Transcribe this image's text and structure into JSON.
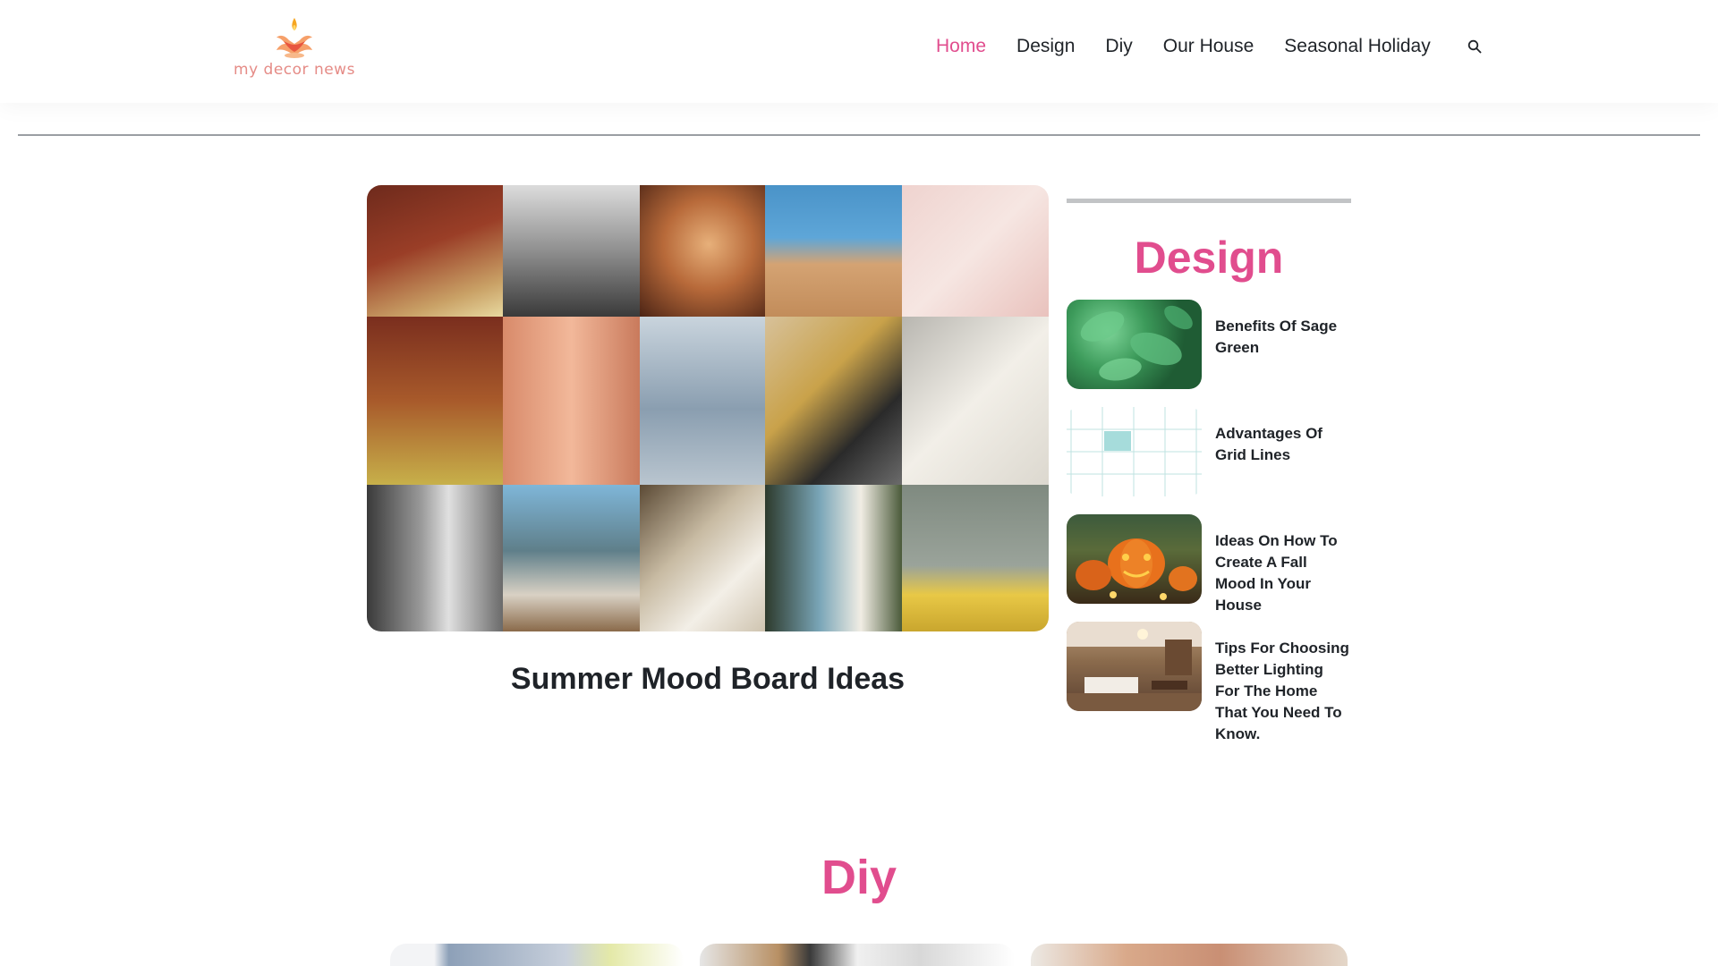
{
  "site": {
    "logo_text": "my decor news",
    "logo_icon": "diya-lamp-icon"
  },
  "nav": {
    "items": [
      {
        "label": "Home",
        "active": true
      },
      {
        "label": "Design",
        "active": false
      },
      {
        "label": "Diy",
        "active": false
      },
      {
        "label": "Our House",
        "active": false
      },
      {
        "label": "Seasonal Holiday",
        "active": false
      }
    ],
    "search_icon": "search-icon"
  },
  "colors": {
    "accent": "#e14d8e",
    "text": "#1f2328",
    "divider": "#9a9ea3",
    "logo": "#e58b86"
  },
  "featured": {
    "title": "Summer Mood Board Ideas",
    "image": "summer-mood-board-collage"
  },
  "sidebar": {
    "title": "Design",
    "posts": [
      {
        "title": "Benefits Of Sage Green",
        "thumb": "sage-leaves"
      },
      {
        "title": "Advantages Of Grid Lines",
        "thumb": "grid-lines"
      },
      {
        "title": "Ideas On How To Create A Fall Mood In Your House",
        "thumb": "pumpkins"
      },
      {
        "title": "Tips For Choosing Better Lighting For The Home That You Need To Know.",
        "thumb": "living-room"
      }
    ]
  },
  "diy": {
    "title": "Diy"
  }
}
